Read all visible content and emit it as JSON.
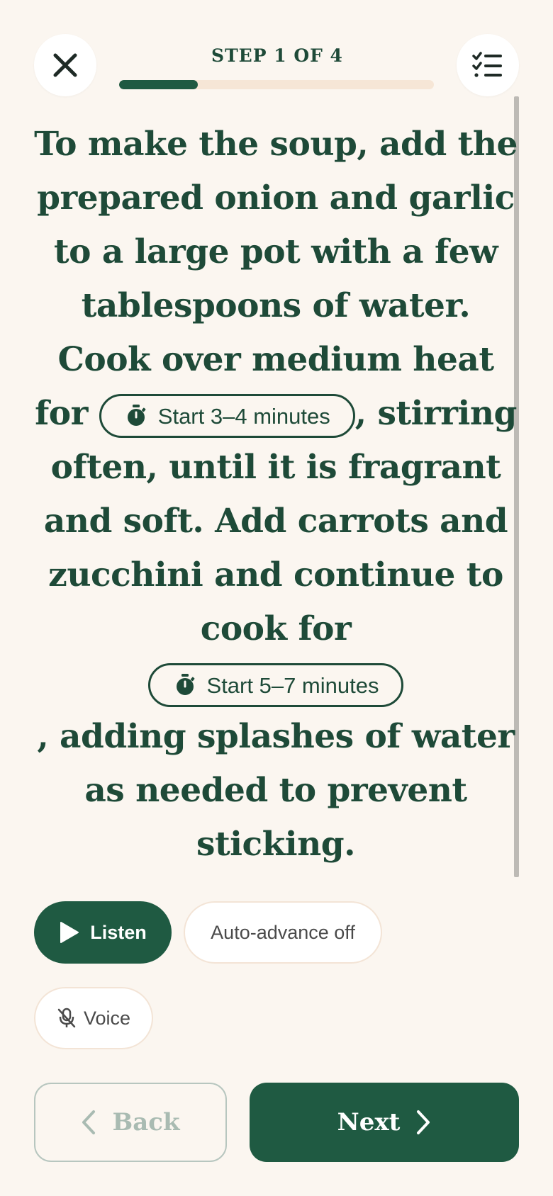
{
  "header": {
    "step_label": "STEP 1 OF 4",
    "progress_fraction": 0.25
  },
  "instruction": {
    "text_1": "To make the soup, add the prepared onion and garlic to a large pot with a few tablespoons of water. Cook over medium heat for",
    "timer_1": "Start 3–4 minutes",
    "text_2": ", stirring often, until it is fragrant and soft. Add carrots and zucchini and continue to cook for",
    "timer_2": "Start 5–7 minutes",
    "text_3": ", adding splashes of water as needed to prevent sticking."
  },
  "controls": {
    "listen_label": "Listen",
    "auto_advance_label": "Auto-advance off",
    "voice_label": "Voice"
  },
  "nav": {
    "back_label": "Back",
    "next_label": "Next"
  },
  "icons": {
    "close": "close-icon",
    "steps_list": "checklist-icon",
    "timer": "stopwatch-icon",
    "play": "play-icon",
    "mic_off": "mic-off-icon",
    "back": "chevron-left-icon",
    "next": "chevron-right-icon"
  },
  "colors": {
    "background": "#fbf6f0",
    "primary": "#1f5a42",
    "text": "#1e4a38",
    "progress_track": "#f6e6d6"
  }
}
